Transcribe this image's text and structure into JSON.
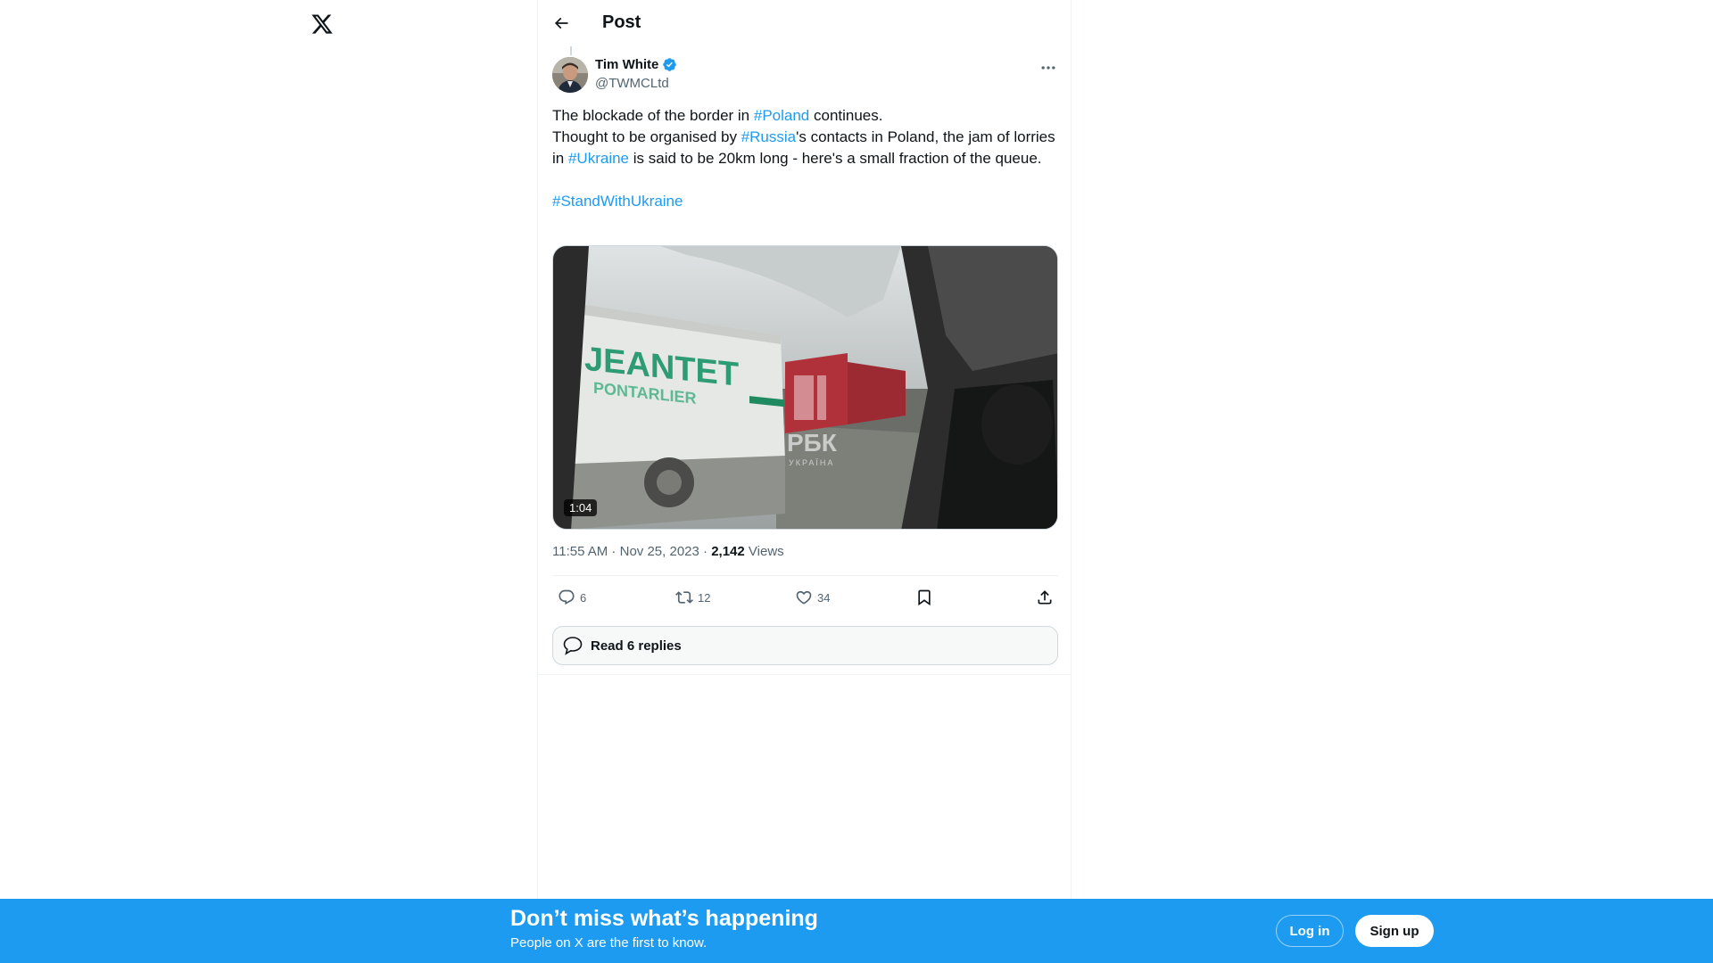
{
  "header": {
    "title": "Post",
    "back_icon": "arrow-left-icon",
    "logo_icon": "x-logo-icon"
  },
  "post": {
    "author_name": "Tim White",
    "author_handle": "@TWMCLtd",
    "verified": true,
    "text": {
      "line1_pre": "The blockade of the border in ",
      "line1_tag": "#Poland",
      "line1_post": " continues.",
      "line2_pre": "Thought to be organised by ",
      "line2_tag1": "#Russia",
      "line2_mid": "'s contacts in Poland, the jam of lorries in ",
      "line2_tag2": "#Ukraine",
      "line2_post": " is said to be 20km long - here's a small fraction of the queue.",
      "line3_tag": "#StandWithUkraine"
    },
    "media": {
      "duration": "1:04",
      "truck_text1": "JEANTET",
      "truck_text2": "PONTARLIER",
      "watermark_main": "РБК",
      "watermark_sub": "УКРАЇНА"
    },
    "time": "11:55 AM",
    "date": "Nov 25, 2023",
    "views_count": "2,142",
    "views_label": "Views",
    "stats": {
      "replies": "6",
      "reposts": "12",
      "likes": "34"
    },
    "read_replies_label": "Read 6 replies"
  },
  "banner": {
    "title": "Don’t miss what’s happening",
    "subtitle": "People on X are the first to know.",
    "login_label": "Log in",
    "signup_label": "Sign up"
  },
  "colors": {
    "accent": "#1d9bf0",
    "text": "#0f1419",
    "secondary": "#536471"
  }
}
